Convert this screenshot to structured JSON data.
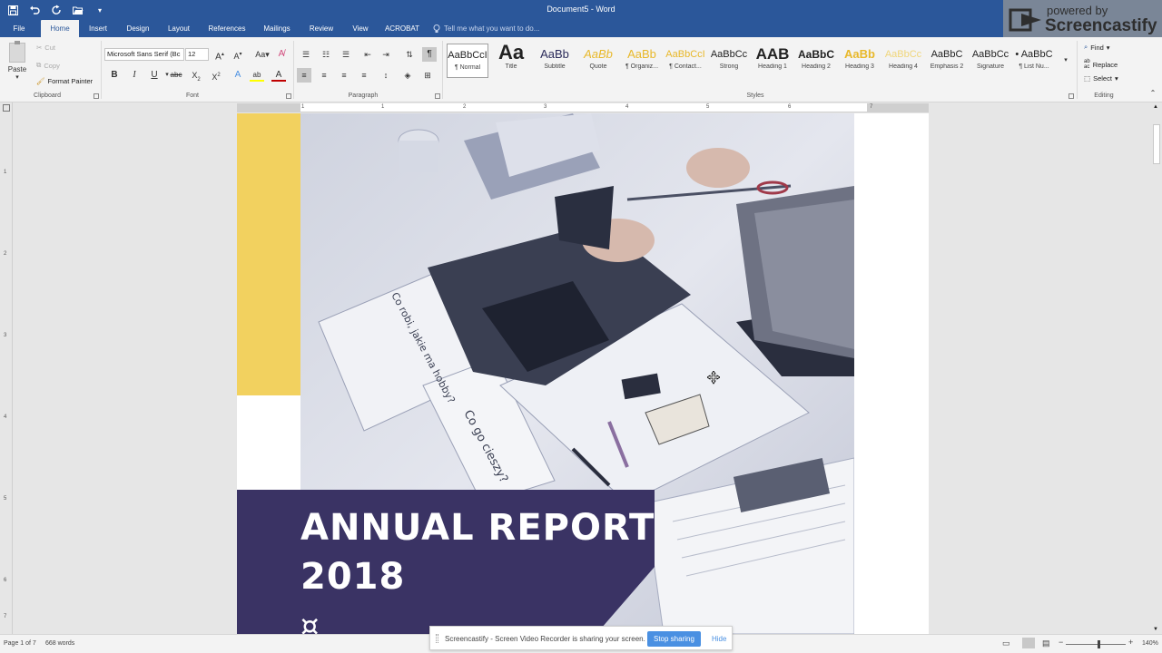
{
  "window": {
    "title": "Document5 - Word"
  },
  "watermark": {
    "pre": "powered by",
    "brand": "Screencastify"
  },
  "tabs": [
    "File",
    "Home",
    "Insert",
    "Design",
    "Layout",
    "References",
    "Mailings",
    "Review",
    "View",
    "ACROBAT"
  ],
  "active_tab": "Home",
  "tell_me": {
    "placeholder": "Tell me what you want to do..."
  },
  "clipboard": {
    "paste": "Paste",
    "cut": "Cut",
    "copy": "Copy",
    "format_painter": "Format Painter",
    "label": "Clipboard"
  },
  "font": {
    "name": "Microsoft Sans Serif (Bc",
    "size": "12",
    "label": "Font",
    "underline_color": "#c00000",
    "highlight_color": "#ffff00",
    "font_color": "#c00000"
  },
  "paragraph": {
    "label": "Paragraph"
  },
  "styles": {
    "label": "Styles",
    "items": [
      {
        "sample": "AaBbCcI",
        "name": "¶ Normal"
      },
      {
        "sample": "Aa",
        "name": "Title"
      },
      {
        "sample": "AaBb",
        "name": "Subtitle"
      },
      {
        "sample": "AaBb",
        "name": "Quote"
      },
      {
        "sample": "AaBb",
        "name": "¶ Organiz..."
      },
      {
        "sample": "AaBbCcI",
        "name": "¶ Contact..."
      },
      {
        "sample": "AaBbCc",
        "name": "Strong"
      },
      {
        "sample": "AAB",
        "name": "Heading 1"
      },
      {
        "sample": "AaBbC",
        "name": "Heading 2"
      },
      {
        "sample": "AaBb",
        "name": "Heading 3"
      },
      {
        "sample": "AaBbCc",
        "name": "Heading 4"
      },
      {
        "sample": "AaBbC",
        "name": "Emphasis 2"
      },
      {
        "sample": "AaBbCc",
        "name": "Signature"
      },
      {
        "sample": "• AaBbC",
        "name": "¶ List Nu..."
      }
    ]
  },
  "editing": {
    "label": "Editing",
    "find": "Find",
    "replace": "Replace",
    "select": "Select"
  },
  "ruler": {
    "h_marks": [
      "1",
      "1",
      "2",
      "3",
      "4",
      "5",
      "6",
      "7"
    ],
    "v_marks": [
      "1",
      "2",
      "3",
      "4",
      "5",
      "6",
      "7"
    ]
  },
  "document": {
    "title_line1": "ANNUAL REPORT",
    "title_line2": "2018",
    "accent_yellow": "#f2d15f",
    "banner_color": "#3a3364"
  },
  "status": {
    "page": "Page 1 of 7",
    "words": "668 words",
    "zoom": "140%"
  },
  "share_bar": {
    "message": "Screencastify - Screen Video Recorder is sharing your screen.",
    "stop": "Stop sharing",
    "hide": "Hide"
  }
}
